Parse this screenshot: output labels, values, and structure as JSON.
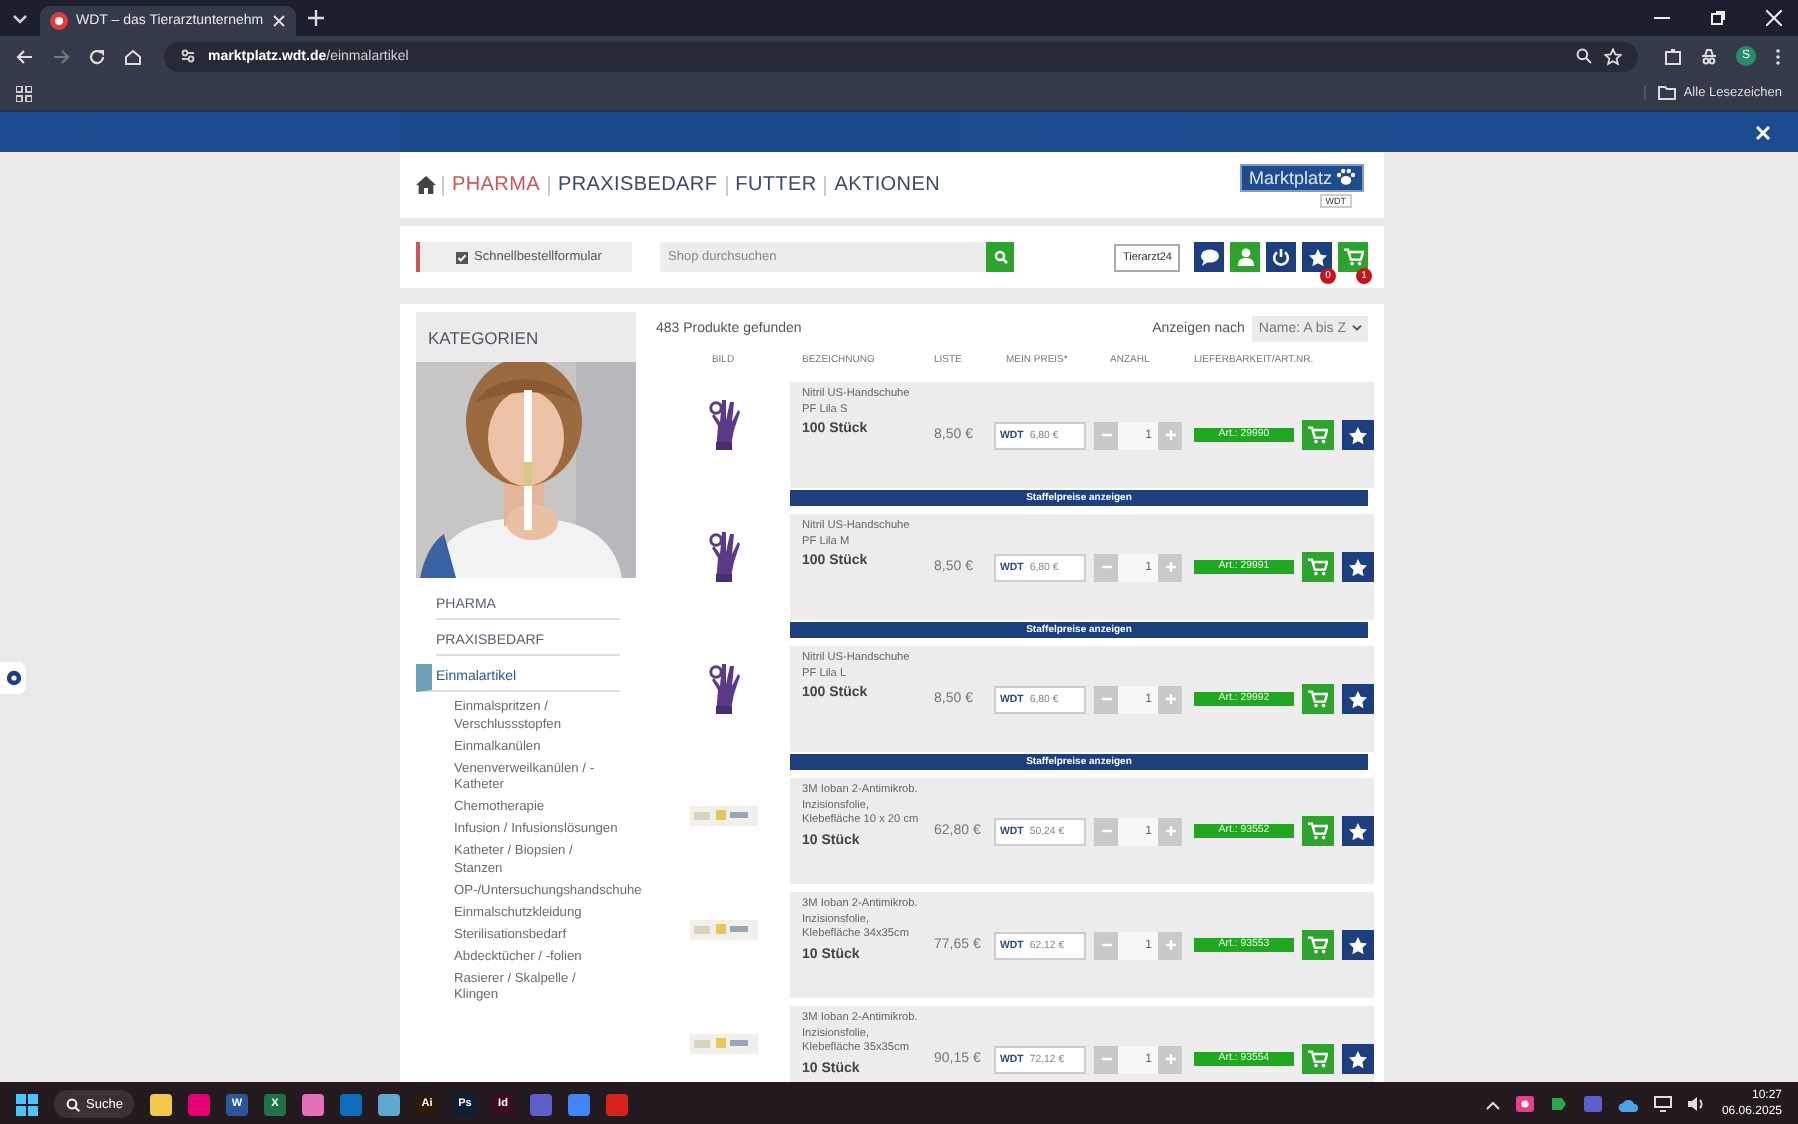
{
  "browser": {
    "tab_title": "WDT – das Tierarztunternehm",
    "url_domain": "marktplatz.wdt.de",
    "url_path": "/einmalartikel",
    "profile_initial": "S",
    "bookmarks_label": "Alle Lesezeichen"
  },
  "nav": {
    "items": [
      {
        "label": "PHARMA",
        "selected": true
      },
      {
        "label": "PRAXISBEDARF",
        "selected": false
      },
      {
        "label": "FUTTER",
        "selected": false
      },
      {
        "label": "AKTIONEN",
        "selected": false
      }
    ],
    "logo_title": "Marktplatz",
    "logo_sub": "WDT"
  },
  "toolbar": {
    "quick_order": "Schnellbestellformular",
    "search": {
      "placeholder": "Shop durchsuchen"
    },
    "partner": "Tierarzt24",
    "favorites_count": "0",
    "cart_count": "1"
  },
  "sidebar": {
    "title": "KATEGORIEN",
    "categories": [
      {
        "label": "PHARMA",
        "selected": false
      },
      {
        "label": "PRAXISBEDARF",
        "selected": false
      },
      {
        "label": "Einmalartikel",
        "selected": true,
        "children": [
          {
            "label": "Einmalspritzen / Verschlussstopfen"
          },
          {
            "label": "Einmalkanülen"
          },
          {
            "label": "Venenverweilkanülen / -Katheter"
          },
          {
            "label": "Chemotherapie"
          },
          {
            "label": "Infusion / Infusionslösungen"
          },
          {
            "label": "Katheter / Biopsien / Stanzen"
          },
          {
            "label": "OP-/Untersuchungshandschuhe"
          },
          {
            "label": "Einmalschutzkleidung"
          },
          {
            "label": "Sterilisationsbedarf"
          },
          {
            "label": "Abdecktücher / -folien"
          },
          {
            "label": "Rasierer / Skalpelle / Klingen"
          }
        ]
      }
    ]
  },
  "results": {
    "count": "483 Produkte gefunden",
    "sort_label": "Anzeigen nach",
    "sort_value": "Name: A bis Z",
    "columns": [
      "BILD",
      "BEZEICHNUNG",
      "LISTE",
      "MEIN PREIS*",
      "ANZAHL",
      "LIEFERBARKEIT/ART.NR."
    ]
  },
  "products": [
    {
      "kind": "glove",
      "name": "Nitril US-Handschuhe PF Lila S",
      "pack": "100 Stück",
      "list_price": "8,50 €",
      "price_brand": "WDT",
      "my_price": "6,80 €",
      "quantity": "1",
      "article": "Art.: 29990",
      "tier_link": "Staffelpreise anzeigen"
    },
    {
      "kind": "glove",
      "name": "Nitril US-Handschuhe PF Lila M",
      "pack": "100 Stück",
      "list_price": "8,50 €",
      "price_brand": "WDT",
      "my_price": "6,80 €",
      "quantity": "1",
      "article": "Art.: 29991",
      "tier_link": "Staffelpreise anzeigen"
    },
    {
      "kind": "glove",
      "name": "Nitril US-Handschuhe PF Lila L",
      "pack": "100 Stück",
      "list_price": "8,50 €",
      "price_brand": "WDT",
      "my_price": "6,80 €",
      "quantity": "1",
      "article": "Art.: 29992",
      "tier_link": "Staffelpreise anzeigen"
    },
    {
      "kind": "strip",
      "name": "3M Ioban 2-Antimikrob. Inzisionsfolie, Klebefläche 10 x 20 cm",
      "pack": "10 Stück",
      "list_price": "62,80 €",
      "price_brand": "WDT",
      "my_price": "50,24 €",
      "quantity": "1",
      "article": "Art.: 93552"
    },
    {
      "kind": "strip",
      "name": "3M Ioban 2-Antimikrob. Inzisionsfolie, Klebefläche 34x35cm",
      "pack": "10 Stück",
      "list_price": "77,65 €",
      "price_brand": "WDT",
      "my_price": "62,12 €",
      "quantity": "1",
      "article": "Art.: 93553"
    },
    {
      "kind": "strip",
      "name": "3M Ioban 2-Antimikrob. Inzisionsfolie, Klebefläche 35x35cm",
      "pack": "10 Stück",
      "list_price": "90,15 €",
      "price_brand": "WDT",
      "my_price": "72,12 €",
      "quantity": "1",
      "article": "Art.: 93554"
    }
  ],
  "taskbar": {
    "search": "Suche",
    "apps": [
      {
        "color": "#f2c94c"
      },
      {
        "color": "#e20074"
      },
      {
        "color": "#2b579a",
        "label": "W"
      },
      {
        "color": "#217346",
        "label": "X"
      },
      {
        "color": "#e36fb8"
      },
      {
        "color": "#0f6cbd"
      },
      {
        "color": "#5fa8d3"
      },
      {
        "color": "#2c1a08",
        "label": "Ai"
      },
      {
        "color": "#0a1e36",
        "label": "Ps"
      },
      {
        "color": "#3b0c22",
        "label": "Id"
      },
      {
        "color": "#5b5fc7"
      },
      {
        "color": "#4285f4"
      },
      {
        "color": "#d9221c"
      }
    ],
    "time": "10:27",
    "date": "06.06.2025"
  }
}
